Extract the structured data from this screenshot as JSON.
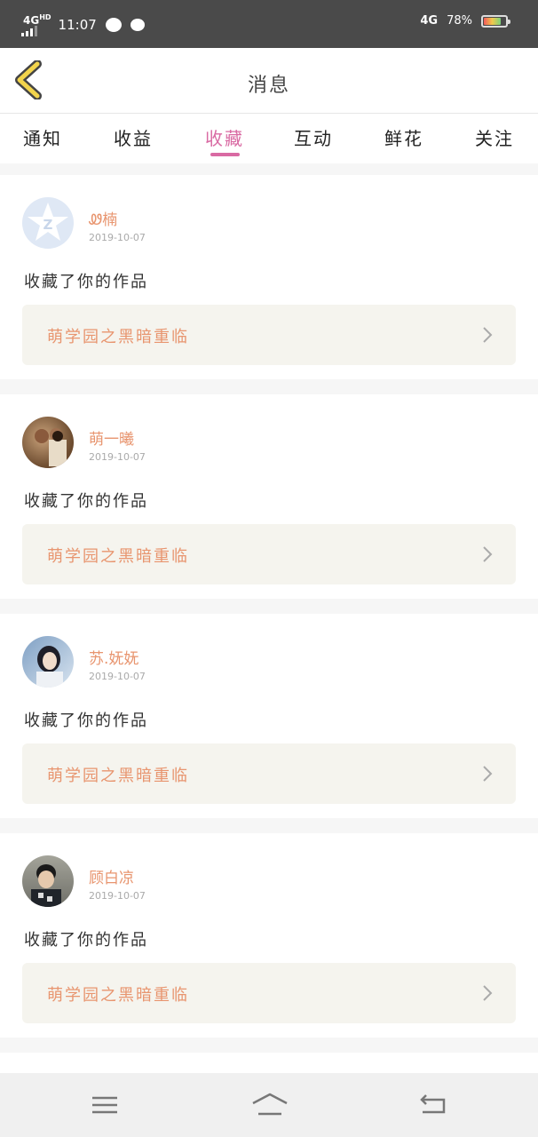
{
  "status_bar": {
    "network": "4G",
    "network_sup": "HD",
    "time": "11:07",
    "right_network": "4G",
    "battery": "78%",
    "battery_level": 0.78
  },
  "header": {
    "title": "消息"
  },
  "tabs": [
    {
      "label": "通知"
    },
    {
      "label": "收益"
    },
    {
      "label": "收藏"
    },
    {
      "label": "互动"
    },
    {
      "label": "鲜花"
    },
    {
      "label": "关注"
    }
  ],
  "active_tab": "收藏",
  "items": [
    {
      "user": "Ꮺ楠",
      "date": "2019-10-07",
      "action": "收藏了你的作品",
      "work": "萌学园之黑暗重临",
      "avatar": "qq-default-avatar"
    },
    {
      "user": "萌一曦",
      "date": "2019-10-07",
      "action": "收藏了你的作品",
      "work": "萌学园之黑暗重临",
      "avatar": "photo-avatar"
    },
    {
      "user": "苏.妩妩",
      "date": "2019-10-07",
      "action": "收藏了你的作品",
      "work": "萌学园之黑暗重临",
      "avatar": "photo-avatar"
    },
    {
      "user": "顾白凉",
      "date": "2019-10-07",
      "action": "收藏了你的作品",
      "work": "萌学园之黑暗重临",
      "avatar": "photo-avatar"
    }
  ],
  "colors": {
    "accent": "#d96aa3",
    "name": "#e8956f",
    "card_bg": "#f5f4ee"
  }
}
